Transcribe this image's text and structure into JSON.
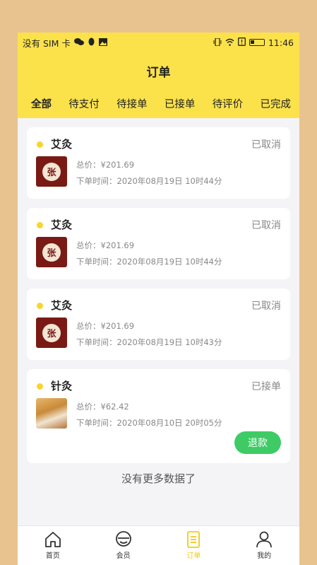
{
  "status_bar": {
    "carrier": "没有 SIM 卡",
    "time": "11:46"
  },
  "header": {
    "title": "订单"
  },
  "tabs": [
    {
      "label": "全部",
      "active": true
    },
    {
      "label": "待支付"
    },
    {
      "label": "待接单"
    },
    {
      "label": "已接单"
    },
    {
      "label": "待评价"
    },
    {
      "label": "已完成"
    }
  ],
  "orders": [
    {
      "name": "艾灸",
      "status": "已取消",
      "price": "总价：¥201.69",
      "time": "下单时间：2020年08月19日 10时44分",
      "thumb_text": "张"
    },
    {
      "name": "艾灸",
      "status": "已取消",
      "price": "总价：¥201.69",
      "time": "下单时间：2020年08月19日 10时44分",
      "thumb_text": "张"
    },
    {
      "name": "艾灸",
      "status": "已取消",
      "price": "总价：¥201.69",
      "time": "下单时间：2020年08月19日 10时43分",
      "thumb_text": "张"
    },
    {
      "name": "针灸",
      "status": "已接单",
      "price": "总价：¥62.42",
      "time": "下单时间：2020年08月10日 20时05分",
      "action": "退款"
    }
  ],
  "footer_text": "没有更多数据了",
  "bottom_nav": [
    {
      "label": "首页",
      "icon": "home-icon"
    },
    {
      "label": "会员",
      "icon": "member-icon"
    },
    {
      "label": "订单",
      "icon": "orders-icon",
      "active": true
    },
    {
      "label": "我的",
      "icon": "profile-icon"
    }
  ],
  "colors": {
    "accent_yellow": "#fbe24a",
    "refund_green": "#3ecb66",
    "active_nav": "#f4c916"
  }
}
